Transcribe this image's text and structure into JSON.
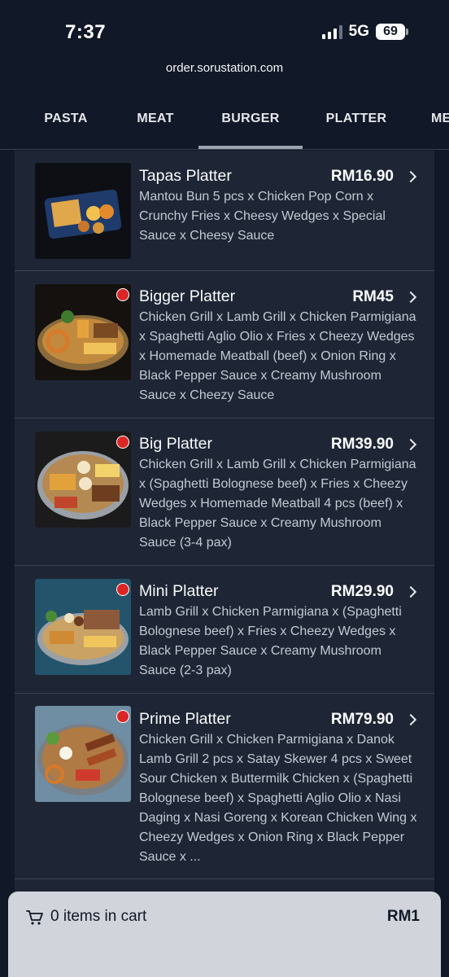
{
  "status": {
    "time": "7:37",
    "network": "5G",
    "battery": "69"
  },
  "browser": {
    "url": "order.sorustation.com"
  },
  "tabs": [
    {
      "label": "PASTA"
    },
    {
      "label": "MEAT"
    },
    {
      "label": "BURGER"
    },
    {
      "label": "PLATTER"
    },
    {
      "label": "ME"
    }
  ],
  "items": [
    {
      "name": "Tapas Platter",
      "price": "RM16.90",
      "desc": "Mantou Bun 5 pcs x Chicken Pop Corn x Crunchy Fries x Cheesy Wedges x Special Sauce x Cheesy Sauce"
    },
    {
      "name": "Bigger Platter",
      "price": "RM45",
      "desc": "Chicken Grill x Lamb Grill x Chicken Parmigiana x Spaghetti Aglio Olio x Fries x Cheezy Wedges x Homemade Meatball (beef) x Onion Ring x Black Pepper Sauce x Creamy Mushroom Sauce x Cheezy Sauce"
    },
    {
      "name": "Big Platter",
      "price": "RM39.90",
      "desc": "Chicken Grill x Lamb Grill x Chicken Parmigiana x (Spaghetti Bolognese beef) x Fries x Cheezy Wedges x Homemade Meatball 4 pcs (beef) x Black Pepper Sauce x Creamy Mushroom Sauce (3-4 pax)"
    },
    {
      "name": "Mini Platter",
      "price": "RM29.90",
      "desc": "Lamb Grill x Chicken Parmigiana x (Spaghetti Bolognese beef) x Fries x Cheezy Wedges x Black Pepper Sauce x Creamy Mushroom Sauce (2-3 pax)"
    },
    {
      "name": "Prime Platter",
      "price": "RM79.90",
      "desc": "Chicken Grill x Chicken Parmigiana x Danok Lamb Grill 2 pcs x Satay Skewer 4 pcs x Sweet Sour Chicken x Buttermilk Chicken x (Spaghetti Bolognese beef) x Spaghetti Aglio Olio x Nasi Daging x Nasi Goreng x Korean Chicken Wing x Cheezy Wedges x Onion Ring x Black Pepper Sauce x ..."
    }
  ],
  "cart": {
    "items_label": "0 items in cart",
    "total": "RM1"
  }
}
